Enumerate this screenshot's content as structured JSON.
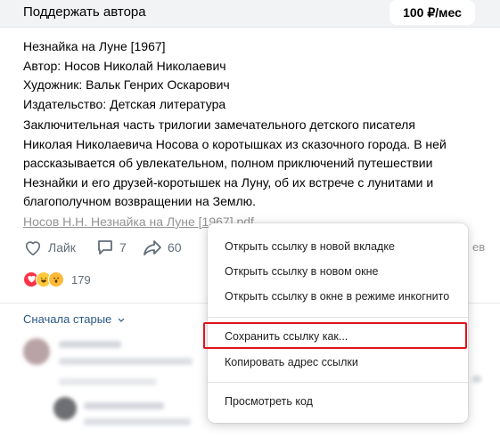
{
  "support": {
    "label": "Поддержать автора",
    "price": "100 ₽/мес"
  },
  "post": {
    "meta": [
      "Незнайка на Луне [1967]",
      "Автор: Носов Николай Николаевич",
      "Художник: Вальк Генрих Оскарович",
      "Издательство: Детская литература"
    ],
    "description": "Заключительная часть трилогии замечательного детского писателя Николая Николаевича Носова о коротышках из сказочного города. В ней рассказывается об увлекательном, полном приключений путешествии Незнайки и его друзей-коротышек на Луну, об их встрече с лунитами и благополучном возвращении на Землю.",
    "file_link": "Носов Н.Н. Незнайка на Луне [1967].pdf"
  },
  "actions": {
    "like_label": "Лайк",
    "comments_count": "7",
    "shares_count": "60",
    "views_suffix": "ев"
  },
  "reactions": {
    "count": "179"
  },
  "comments": {
    "sort_label": "Сначала старые"
  },
  "context_menu": {
    "items": [
      "Открыть ссылку в новой вкладке",
      "Открыть ссылку в новом окне",
      "Открыть ссылку в окне в режиме инкогнито",
      "Сохранить ссылку как...",
      "Копировать адрес ссылки",
      "Просмотреть код"
    ]
  },
  "colors": {
    "highlight": "#e0141d",
    "link": "#2a5885",
    "muted": "#939393"
  }
}
